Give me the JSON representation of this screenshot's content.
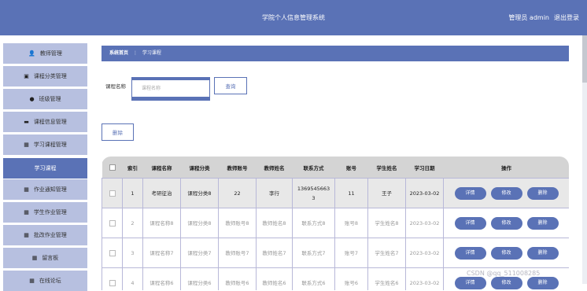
{
  "header": {
    "title": "学院个人信息管理系统",
    "user_label": "管理员 admin",
    "logout_label": "退出登录"
  },
  "sidebar": {
    "items": [
      {
        "label": "教师管理",
        "icon": "user-icon",
        "glyph": "👤"
      },
      {
        "label": "课程分类管理",
        "icon": "book-icon",
        "glyph": "▣"
      },
      {
        "label": "班级管理",
        "icon": "location-icon",
        "glyph": "●"
      },
      {
        "label": "课程信息管理",
        "icon": "monitor-icon",
        "glyph": "▬"
      },
      {
        "label": "学习课程管理",
        "icon": "grid-icon",
        "glyph": "▦"
      },
      {
        "label": "学习课程",
        "icon": "",
        "glyph": ""
      },
      {
        "label": "作业通知管理",
        "icon": "grid-icon",
        "glyph": "▦"
      },
      {
        "label": "学生作业管理",
        "icon": "grid-icon",
        "glyph": "▦"
      },
      {
        "label": "批改作业管理",
        "icon": "grid-icon",
        "glyph": "▦"
      },
      {
        "label": "留言板",
        "icon": "grid-icon",
        "glyph": "▦"
      },
      {
        "label": "在线论坛",
        "icon": "grid-icon",
        "glyph": "▦"
      }
    ]
  },
  "breadcrumb": {
    "home": "系统首页",
    "separator": "⋮",
    "current": "学习课程"
  },
  "search": {
    "label": "课程名称",
    "placeholder": "课程名称",
    "button": "查询"
  },
  "actions": {
    "delete": "删除"
  },
  "table": {
    "columns": [
      "索引",
      "课程名称",
      "课程分类",
      "教师账号",
      "教师姓名",
      "联系方式",
      "账号",
      "学生姓名",
      "学习日期",
      "操作"
    ],
    "rows": [
      {
        "index": "1",
        "course": "考研征治",
        "category": "课程分类8",
        "teacher_account": "22",
        "teacher_name": "李行",
        "contact": "13695456633",
        "account": "11",
        "student": "王子",
        "date": "2023-03-02"
      },
      {
        "index": "2",
        "course": "课程名称8",
        "category": "课程分类8",
        "teacher_account": "教师账号8",
        "teacher_name": "教师姓名8",
        "contact": "联系方式8",
        "account": "账号8",
        "student": "学生姓名8",
        "date": "2023-03-02"
      },
      {
        "index": "3",
        "course": "课程名称7",
        "category": "课程分类7",
        "teacher_account": "教师账号7",
        "teacher_name": "教师姓名7",
        "contact": "联系方式7",
        "account": "账号7",
        "student": "学生姓名7",
        "date": "2023-03-02"
      },
      {
        "index": "4",
        "course": "课程名称6",
        "category": "课程分类6",
        "teacher_account": "教师账号6",
        "teacher_name": "教师姓名6",
        "contact": "联系方式6",
        "account": "账号6",
        "student": "学生姓名6",
        "date": "2023-03-02"
      }
    ],
    "row_actions": [
      "详情",
      "修改",
      "删除"
    ]
  },
  "watermark": "CSDN @qq_511008285",
  "colors": {
    "primary": "#5a72b6",
    "sidebar_item": "#b7c0e0",
    "header_row": "#d4d4d4"
  }
}
